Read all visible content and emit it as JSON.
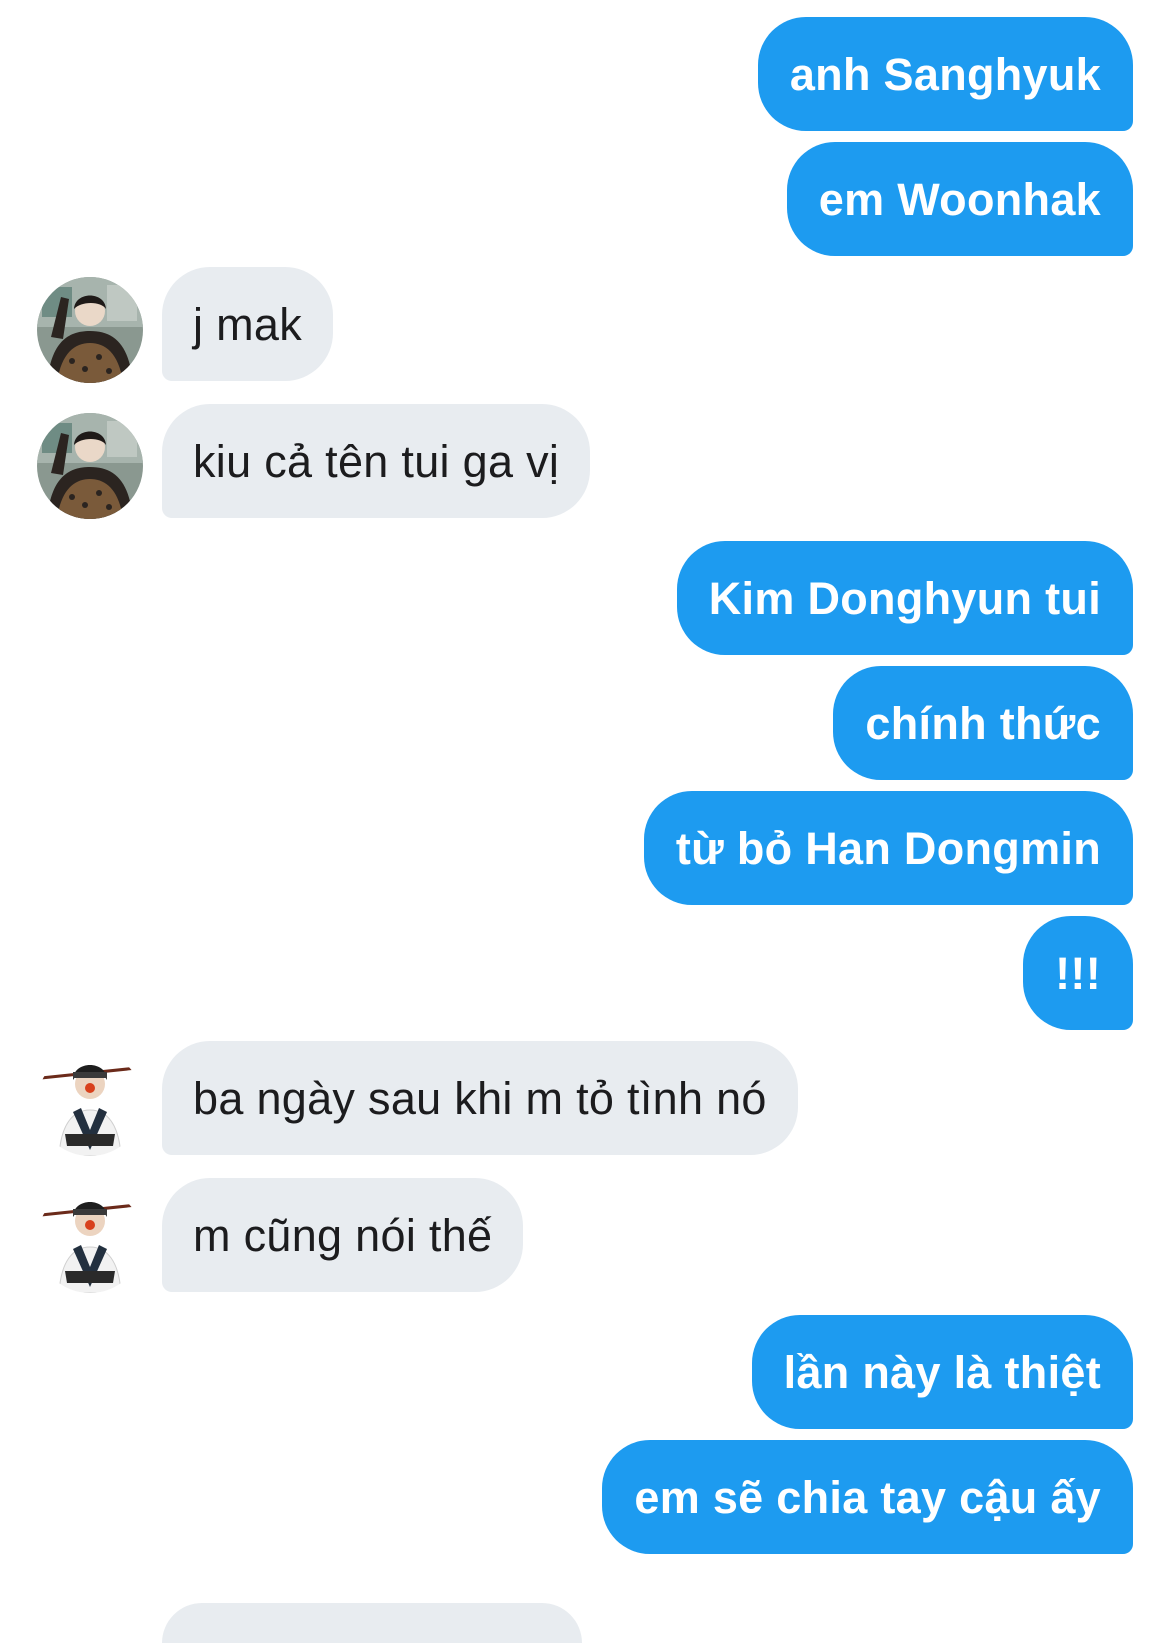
{
  "conversation": {
    "messages": [
      {
        "side": "out",
        "text": "anh Sanghyuk"
      },
      {
        "side": "out",
        "text": "em Woonhak"
      },
      {
        "side": "in",
        "text": "j mak",
        "avatar": "avatar-1"
      },
      {
        "side": "in",
        "text": "kiu cả tên tui ga vị",
        "avatar": "avatar-1"
      },
      {
        "side": "out",
        "text": "Kim Donghyun tui"
      },
      {
        "side": "out",
        "text": "chính thức"
      },
      {
        "side": "out",
        "text": "từ bỏ Han Dongmin"
      },
      {
        "side": "out",
        "text": "!!!"
      },
      {
        "side": "in",
        "text": "ba ngày sau khi m tỏ tình nó",
        "avatar": "avatar-2"
      },
      {
        "side": "in",
        "text": "m cũng nói thế",
        "avatar": "avatar-2"
      },
      {
        "side": "out",
        "text": "lần này là thiệt"
      },
      {
        "side": "out",
        "text": "em sẽ chia tay cậu ấy"
      }
    ]
  },
  "colors": {
    "outgoing_bubble": "#1d9bf0",
    "outgoing_text": "#ffffff",
    "incoming_bubble": "#e8ecf0",
    "incoming_text": "#1c1c1e",
    "background": "#ffffff"
  }
}
